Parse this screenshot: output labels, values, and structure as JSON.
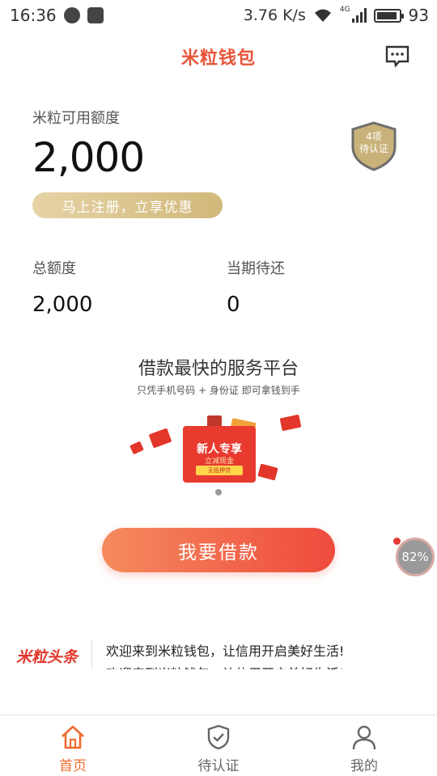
{
  "status_bar": {
    "time": "16:36",
    "network_speed": "3.76 K/s",
    "network_type": "4G",
    "battery": "93",
    "battery_level": 0.93
  },
  "header": {
    "brand": "米粒钱包"
  },
  "credit": {
    "label": "米粒可用额度",
    "amount": "2,000",
    "register_button": "马上注册，立享优惠",
    "badge_line1": "4项",
    "badge_line2": "待认证"
  },
  "stats": [
    {
      "label": "总额度",
      "value": "2,000"
    },
    {
      "label": "当期待还",
      "value": "0"
    }
  ],
  "banner": {
    "title": "借款最快的服务平台",
    "subtitle": "只凭手机号码 + 身份证 即可拿钱到手",
    "promo_title": "新人专享",
    "promo_sub": "立减现金",
    "promo_tag": "无抵押贷"
  },
  "loan_button": "我要借款",
  "float_ball": "82%",
  "news": {
    "logo": "米粒头条",
    "line1": "欢迎来到米粒钱包，让信用开启美好生活!",
    "line2": "欢迎来到米粒钱包，让信用开启美好生活!"
  },
  "nav": [
    {
      "label": "首页",
      "active": true
    },
    {
      "label": "待认证",
      "active": false
    },
    {
      "label": "我的",
      "active": false
    }
  ],
  "colors": {
    "accent": "#f06a2f",
    "brand": "#e8553b",
    "gold": "#d1b87a"
  }
}
